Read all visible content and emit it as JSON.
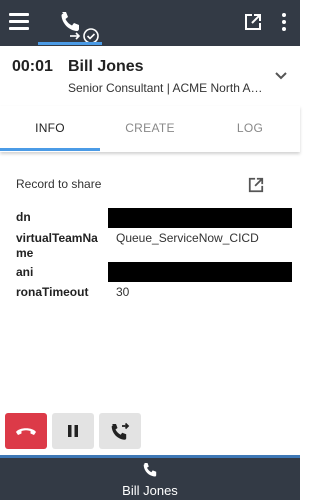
{
  "topbar": {
    "menu_icon": "hamburger-menu-icon",
    "active_tab_icon": "phone-check-icon",
    "popout_icon": "open-in-new-icon",
    "more_icon": "more-vertical-icon",
    "background": "#333a45",
    "accent": "#4b9be6"
  },
  "caller": {
    "timer": "00:01",
    "name": "Bill Jones",
    "title": "Senior Consultant | ACME North America",
    "expand_icon": "chevron-down-icon"
  },
  "tabs": [
    {
      "label": "INFO",
      "active": true
    },
    {
      "label": "CREATE",
      "active": false
    },
    {
      "label": "LOG",
      "active": false
    }
  ],
  "info": {
    "record_label": "Record to share",
    "record_icon": "open-in-new-icon",
    "fields": [
      {
        "key": "dn",
        "value": ""
      },
      {
        "key": "virtualTeamName",
        "value": "Queue_ServiceNow_CICD"
      },
      {
        "key": "ani",
        "value": ""
      },
      {
        "key": "ronaTimeout",
        "value": "30"
      }
    ]
  },
  "controls": {
    "end_call_icon": "hang-up-icon",
    "hold_icon": "pause-icon",
    "transfer_icon": "phone-forward-icon",
    "end_color": "#dc3a48"
  },
  "footer": {
    "icon": "phone-icon",
    "name": "Bill Jones"
  }
}
